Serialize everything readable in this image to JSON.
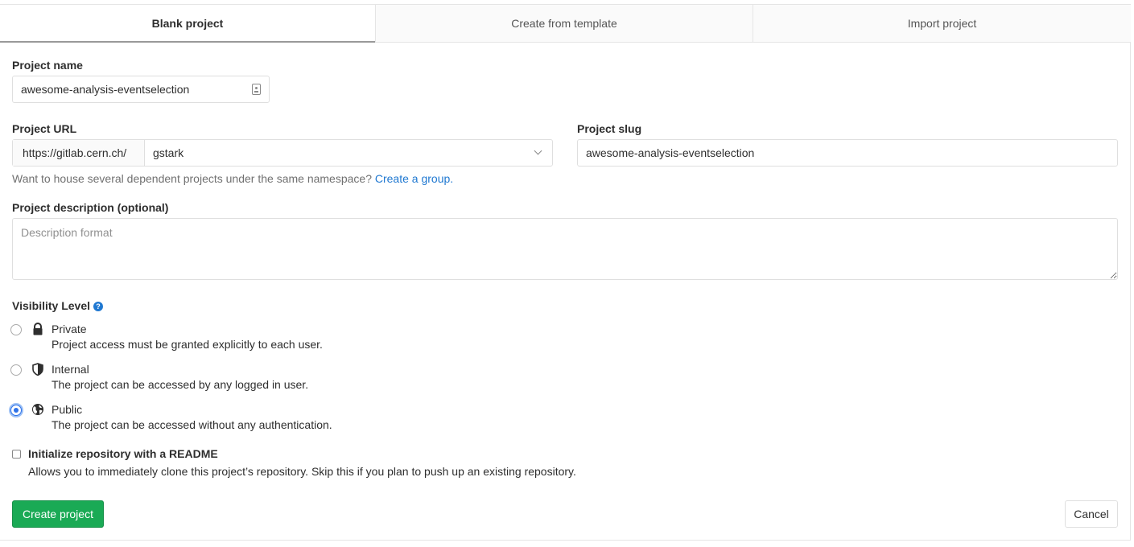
{
  "tabs": [
    {
      "label": "Blank project",
      "active": true
    },
    {
      "label": "Create from template",
      "active": false
    },
    {
      "label": "Import project",
      "active": false
    }
  ],
  "project_name": {
    "label": "Project name",
    "value": "awesome-analysis-eventselection"
  },
  "project_url": {
    "label": "Project URL",
    "prefix": "https://gitlab.cern.ch/",
    "namespace": "gstark"
  },
  "project_slug": {
    "label": "Project slug",
    "value": "awesome-analysis-eventselection"
  },
  "namespace_help": {
    "text": "Want to house several dependent projects under the same namespace?",
    "link": "Create a group."
  },
  "description": {
    "label": "Project description (optional)",
    "placeholder": "Description format"
  },
  "visibility": {
    "label": "Visibility Level",
    "help_icon": "?",
    "selected": "public",
    "options": [
      {
        "id": "private",
        "title": "Private",
        "description": "Project access must be granted explicitly to each user.",
        "icon": "lock-icon"
      },
      {
        "id": "internal",
        "title": "Internal",
        "description": "The project can be accessed by any logged in user.",
        "icon": "shield-icon"
      },
      {
        "id": "public",
        "title": "Public",
        "description": "The project can be accessed without any authentication.",
        "icon": "globe-icon"
      }
    ]
  },
  "readme": {
    "label": "Initialize repository with a README",
    "description": "Allows you to immediately clone this project’s repository. Skip this if you plan to push up an existing repository.",
    "checked": false
  },
  "buttons": {
    "create": "Create project",
    "cancel": "Cancel"
  },
  "colors": {
    "primary_green": "#1aaa55",
    "link_blue": "#1f78d1",
    "radio_blue": "#2f72e8"
  }
}
